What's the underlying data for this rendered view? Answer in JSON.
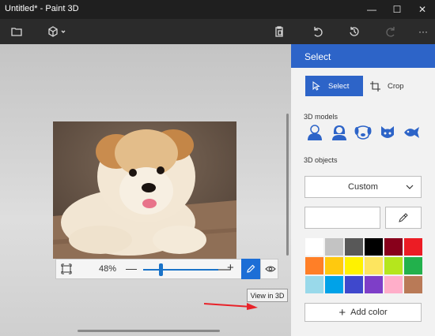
{
  "window": {
    "title": "Untitled* - Paint 3D",
    "minimize": "—",
    "maximize": "☐",
    "close": "✕"
  },
  "toolbar": {
    "more": "···"
  },
  "zoom": {
    "percent": "48%",
    "minus": "—",
    "plus": "+",
    "level": 0.48
  },
  "tooltip": "View in 3D",
  "panel": {
    "header": "Select",
    "select_label": "Select",
    "crop_label": "Crop",
    "models_label": "3D models",
    "objects_label": "3D objects",
    "objects_dropdown": "Custom",
    "add_color": "Add color"
  },
  "palette": {
    "colors": [
      "#ffffff",
      "#c3c3c3",
      "#585858",
      "#000000",
      "#88001b",
      "#ec1c24",
      "#ff7f27",
      "#ffc90e",
      "#fff200",
      "#fde55f",
      "#b5e61d",
      "#22b14c",
      "#99d9ea",
      "#00a2e8",
      "#3f48cc",
      "#7e3ec8",
      "#ffaec9",
      "#b97a57"
    ]
  }
}
